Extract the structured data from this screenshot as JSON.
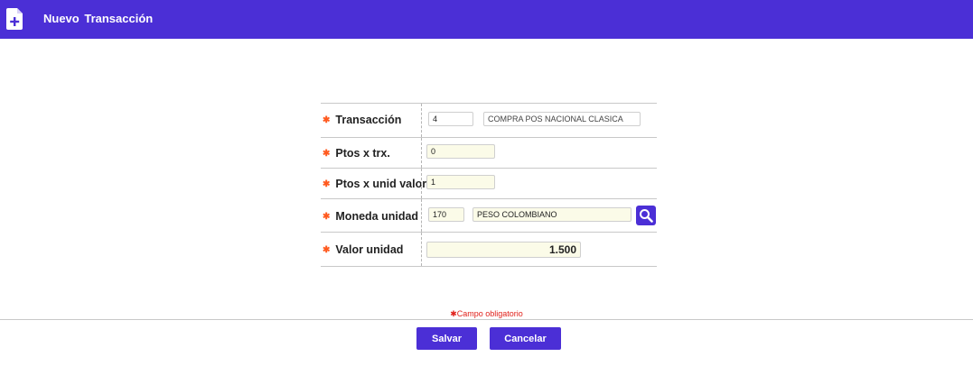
{
  "header": {
    "icon": "file-add-icon",
    "title": "Nuevo Transacción"
  },
  "form": {
    "rows": [
      {
        "label": "Transacción",
        "code": "4",
        "description": "COMPRA POS NACIONAL CLASICA"
      },
      {
        "label": "Ptos x trx.",
        "value": "0"
      },
      {
        "label": "Ptos x unid valor",
        "value": "1"
      },
      {
        "label": "Moneda unidad",
        "code": "170",
        "description": "PESO COLOMBIANO",
        "lookup_icon": "search-icon"
      },
      {
        "label": "Valor unidad",
        "value": "1.500"
      }
    ],
    "required_marker": "✱"
  },
  "required_note": "Campo obligatorio",
  "buttons": {
    "save": "Salvar",
    "cancel": "Cancelar"
  },
  "colors": {
    "header": "#4b2fd6",
    "button": "#4b2fd6",
    "required_star": "#ff5a1f",
    "required_note": "#e0201a"
  }
}
